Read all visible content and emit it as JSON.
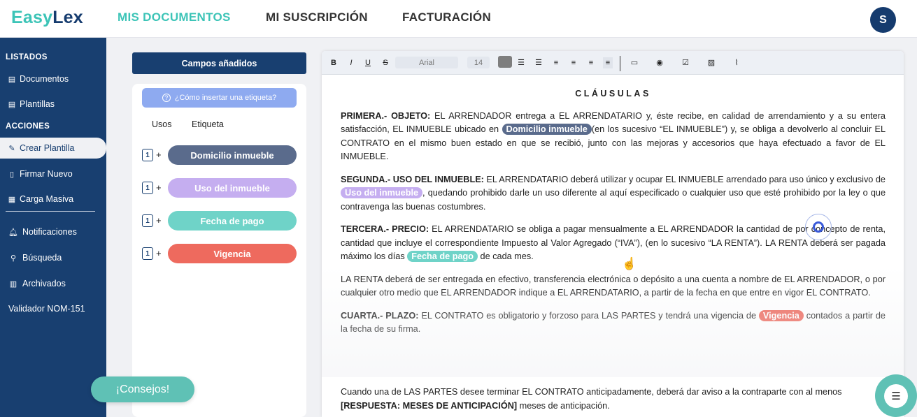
{
  "app": {
    "logo_part1": "Easy",
    "logo_part2": "Lex",
    "avatar_initial": "S"
  },
  "topnav": [
    {
      "label": "MIS DOCUMENTOS",
      "active": true,
      "color": "#3cc4b7"
    },
    {
      "label": "MI SUSCRIPCIÓN",
      "active": false
    },
    {
      "label": "FACTURACIÓN",
      "active": false
    }
  ],
  "sidebar": {
    "section_listados": "LISTADOS",
    "section_acciones": "ACCIONES",
    "items": [
      {
        "label": "Documentos",
        "icon": "document-icon"
      },
      {
        "label": "Plantillas",
        "icon": "template-icon"
      },
      {
        "label": "Crear Plantilla",
        "icon": "edit-icon",
        "active": true
      },
      {
        "label": "Firmar Nuevo",
        "icon": "sign-icon"
      },
      {
        "label": "Carga Masiva",
        "icon": "bulk-upload-icon"
      },
      {
        "label": "Notificaciones",
        "icon": "bell-icon"
      },
      {
        "label": "Búsqueda",
        "icon": "search-icon"
      },
      {
        "label": "Archivados",
        "icon": "archive-icon"
      },
      {
        "label": "Validador NOM-151",
        "icon": ""
      }
    ]
  },
  "fields_panel": {
    "header": "Campos añadidos",
    "help_label": "¿Cómo insertar una etiqueta?",
    "col_usos": "Usos",
    "col_etiqueta": "Etiqueta",
    "tags": [
      {
        "count": "1",
        "label": "Domicilio inmueble",
        "color": "#5a6b8c"
      },
      {
        "count": "1",
        "label": "Uso del inmueble",
        "color": "#c5aef0"
      },
      {
        "count": "1",
        "label": "Fecha de pago",
        "color": "#6fd3c8"
      },
      {
        "count": "1",
        "label": "Vigencia",
        "color": "#ee6a5e"
      }
    ]
  },
  "tips_button": "¡Consejos!",
  "toolbar": {
    "font": "Arial",
    "size": "14",
    "bold": "B",
    "italic": "I",
    "underline": "U",
    "strike": "S"
  },
  "document": {
    "title": "CLÁUSULAS",
    "p1_head": "PRIMERA.- OBJETO:",
    "p1_a": " EL ARRENDADOR entrega a EL ARRENDATARIO y, éste recibe, en calidad de arrendamiento y a su entera satisfacción, EL INMUEBLE ubicado en ",
    "p1_tag": "Domicilio inmueble",
    "p1_b": "(en los sucesivo “EL INMUEBLE”) y, se obliga a devolverlo al concluir EL CONTRATO en el mismo buen estado en que se recibió, junto con las mejoras y accesorios que haya efectuado a favor de EL INMUEBLE.",
    "p2_head": "SEGUNDA.- USO DEL INMUEBLE:",
    "p2_a": " EL ARRENDATARIO deberá utilizar y ocupar EL INMUEBLE arrendado para uso único y exclusivo de ",
    "p2_tag": "Uso del inmueble",
    "p2_b": ", quedando prohibido darle un uso diferente al aquí especificado o cualquier uso que esté prohibido por la ley o que contravenga las buenas costumbres.",
    "p3_head": "TERCERA.- PRECIO:",
    "p3_a": " EL ARRENDATARIO se obliga a pagar mensualmente a EL ARRENDADOR la cantidad de por concepto de renta, cantidad que incluye el correspondiente Impuesto al Valor Agregado (“IVA”), (en lo sucesivo “LA RENTA”). LA RENTA deberá ser pagada máximo los días ",
    "p3_tag": "Fecha de pago",
    "p3_b": " de cada mes.",
    "p4": "LA RENTA deberá de ser entregada en efectivo, transferencia electrónica o depósito a una cuenta a nombre de EL ARRENDADOR, o por cualquier otro medio que EL ARRENDADOR indique a EL ARRENDATARIO, a partir de la fecha en que entre en vigor EL CONTRATO.",
    "p5_head": "CUARTA.- PLAZO:",
    "p5_a": " EL CONTRATO es obligatorio y forzoso para LAS PARTES y tendrá una vigencia de ",
    "p5_tag": "Vigencia",
    "p5_b": " contados a partir de la fecha de su firma.",
    "p6_line1": "Cuando una de LAS PARTES desee terminar EL CONTRATO anticipadamente, deberá dar aviso a la contraparte con al menos",
    "p6_bold": "[RESPUESTA: MESES DE ANTICIPACIÓN]",
    "p6_rest": " meses de anticipación."
  }
}
